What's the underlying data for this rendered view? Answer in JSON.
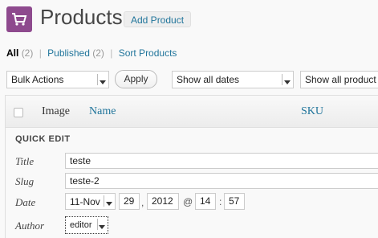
{
  "header": {
    "title": "Products",
    "add_label": "Add Product",
    "logo_icon": "cart-icon",
    "logo_color": "#8e4a8e"
  },
  "filters": {
    "all_label": "All",
    "all_count": "(2)",
    "published_label": "Published",
    "published_count": "(2)",
    "sort_label": "Sort Products"
  },
  "toolbar": {
    "bulk_actions": "Bulk Actions",
    "apply_label": "Apply",
    "dates": "Show all dates",
    "product_types": "Show all product"
  },
  "table": {
    "col_image": "Image",
    "col_name": "Name",
    "col_sku": "SKU"
  },
  "quick_edit": {
    "heading": "QUICK EDIT",
    "title_label": "Title",
    "title_value": "teste",
    "slug_label": "Slug",
    "slug_value": "teste-2",
    "date_label": "Date",
    "month": "11-Nov",
    "day": "29",
    "year": "2012",
    "at": "@",
    "hour": "14",
    "minute": "57",
    "author_label": "Author",
    "author_value": "editor"
  },
  "accent_color": "#21759b"
}
